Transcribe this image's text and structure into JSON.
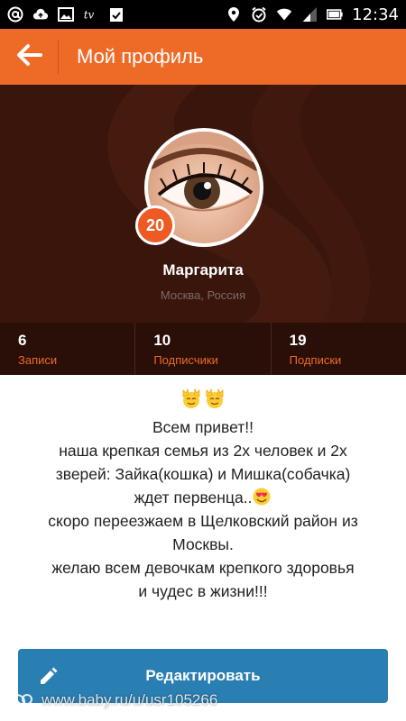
{
  "status_bar": {
    "time": "12:34",
    "icons_left": [
      "at-icon",
      "cloud-upload-icon",
      "image-icon",
      "tv-icon",
      "clipboard-check-icon"
    ],
    "icons_right": [
      "location-icon",
      "alarm-icon",
      "wifi-icon",
      "signal-icon",
      "battery-icon"
    ]
  },
  "app_bar": {
    "title": "Мой профиль",
    "back_icon": "arrow-left-icon"
  },
  "profile": {
    "age": "20",
    "name": "Маргарита",
    "location": "Москва, Россия",
    "stats": [
      {
        "count": "6",
        "label": "Записи"
      },
      {
        "count": "10",
        "label": "Подписчики"
      },
      {
        "count": "19",
        "label": "Подписки"
      }
    ]
  },
  "bio": {
    "line1": "Всем привет!!",
    "line2": "наша крепкая семья из 2х человек и 2х",
    "line3": "зверей: Зайка(кошка) и Мишка(собачка)",
    "line4": "ждет первенца..",
    "line5": "скоро переезжаем в Щелковский район из",
    "line6": "Москвы.",
    "line7": "желаю всем девочкам крепкого здоровья",
    "line8": "и чудес в жизни!!!"
  },
  "edit_button": {
    "label": "Редактировать",
    "icon": "pencil-icon"
  },
  "watermark": {
    "text": "www.baby.ru/u/usr105266"
  },
  "colors": {
    "accent": "#ee6a27",
    "header_bg": "#3a150c",
    "button": "#2a7fb2"
  }
}
